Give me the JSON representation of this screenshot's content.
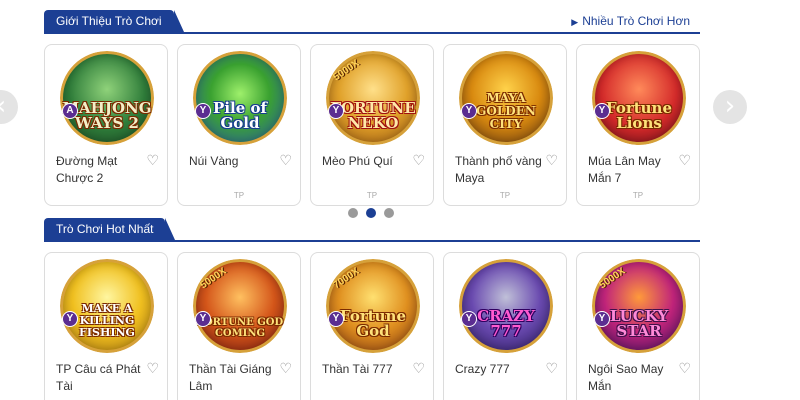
{
  "section1": {
    "title": "Giới Thiệu Trò Chơi",
    "more_link": "Nhiều Trò Chơi Hơn",
    "games": [
      {
        "name": "Đường Mạt Chược 2",
        "provider_badge": "A",
        "provider_label": "",
        "logo_text": "MAHJONG WAYS 2",
        "multiplier": "",
        "heart_icon": "heart-outline-icon"
      },
      {
        "name": "Núi Vàng",
        "provider_badge": "Y",
        "provider_label": "TP",
        "logo_text": "Pile of Gold",
        "multiplier": "",
        "heart_icon": "heart-outline-icon"
      },
      {
        "name": "Mèo Phú Quí",
        "provider_badge": "Y",
        "provider_label": "TP",
        "logo_text": "FORTUNE NEKO",
        "multiplier": "5000X",
        "heart_icon": "heart-outline-icon"
      },
      {
        "name": "Thành phố vàng Maya",
        "provider_badge": "Y",
        "provider_label": "TP",
        "logo_text": "MAYA GOLDEN CITY",
        "multiplier": "",
        "heart_icon": "heart-outline-icon"
      },
      {
        "name": "Múa Lân May Mắn 7",
        "provider_badge": "Y",
        "provider_label": "TP",
        "logo_text": "Fortune Lions",
        "multiplier": "",
        "heart_icon": "heart-outline-icon"
      }
    ]
  },
  "carousel": {
    "pages": 3,
    "active_index": 1
  },
  "section2": {
    "title": "Trò Chơi Hot Nhất",
    "games": [
      {
        "name": "TP Câu cá Phát Tài",
        "provider_badge": "Y",
        "logo_text": "MAKE A KILLING FISHING",
        "multiplier": ""
      },
      {
        "name": "Thần Tài Giáng Lâm",
        "provider_badge": "Y",
        "logo_text": "FORTUNE GOD COMING",
        "multiplier": "5000X"
      },
      {
        "name": "Thần Tài 777",
        "provider_badge": "Y",
        "logo_text": "Fortune God",
        "multiplier": "7000X"
      },
      {
        "name": "Crazy 777",
        "provider_badge": "Y",
        "logo_text": "CRAZY 777",
        "multiplier": ""
      },
      {
        "name": "Ngôi Sao May Mắn",
        "provider_badge": "Y",
        "logo_text": "LUCKY STAR",
        "multiplier": "5000X"
      }
    ]
  },
  "colors": {
    "brand": "#1c3f94",
    "card_border": "#dcdcdc",
    "dot_inactive": "#9a9a9a"
  },
  "icons": {
    "arrow_left": "chevron-left-icon",
    "arrow_right": "chevron-right-icon",
    "heart": "heart-outline-icon"
  }
}
